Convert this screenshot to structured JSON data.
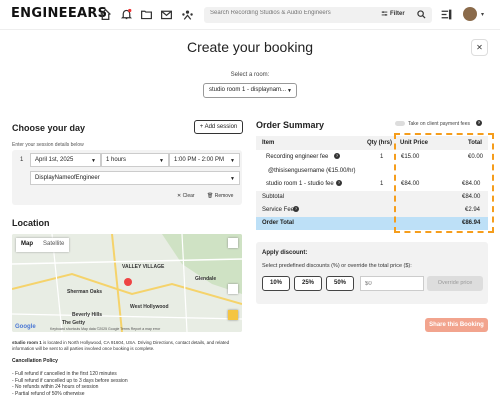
{
  "header": {
    "logo": "ENGINEEARS",
    "search_placeholder": "Search Recording Studios & Audio Engineers",
    "filter_label": "Filter"
  },
  "page": {
    "title": "Create your booking",
    "close": "✕",
    "room_label": "Select a room:",
    "room_value": "studio room 1 - displaynam..."
  },
  "choose_day": {
    "title": "Choose your day",
    "add_session": "+ Add session",
    "hint": "Enter your session details below",
    "session_number": "1",
    "date": "April 1st, 2025",
    "duration": "1 hours",
    "time": "1:00 PM - 2:00 PM",
    "engineer": "DisplayNameofEngineer",
    "clear": "Clear",
    "remove": "Remove"
  },
  "location": {
    "title": "Location",
    "map_tab": "Map",
    "satellite_tab": "Satellite",
    "places": [
      "VALLEY VILLAGE",
      "Glendale",
      "Beverly Hills",
      "West Hollywood",
      "Sherman Oaks",
      "The Getty"
    ],
    "map_footer": "Keyboard shortcuts   Map data ©2025 Google   Terms   Report a map error",
    "google": "Google",
    "room_name": "studio room 1",
    "description": "is located in North Hollywood, CA 91604, USA. Driving Directions, contact details, and related information will be sent to all parties involved once booking is complete."
  },
  "cancellation": {
    "title": "Cancellation Policy",
    "items": [
      "- Full refund if cancelled in the first 120 minutes",
      "- Full refund if cancelled up to 3 days before session",
      "- No refunds within 24 hours of session",
      "- Partial refund of 50% otherwise"
    ]
  },
  "order": {
    "title": "Order Summary",
    "toggle_label": "Take on client payment fees",
    "columns": [
      "Item",
      "Qty (hrs)",
      "Unit Price",
      "Total"
    ],
    "rows": [
      {
        "item": "Recording engineer fee",
        "qty": "1",
        "unit": "€15.00",
        "total": "€0.00"
      },
      {
        "item": "@thisisengusername (€15.00/hr)",
        "qty": "",
        "unit": "",
        "total": ""
      },
      {
        "item": "studio room 1 - studio fee",
        "qty": "1",
        "unit": "€84.00",
        "total": "€84.00"
      }
    ],
    "subtotal_label": "Subtotal",
    "subtotal": "€84.00",
    "service_label": "Service Fee",
    "service": "€2.94",
    "total_label": "Order Total",
    "total": "€86.94"
  },
  "discount": {
    "title": "Apply discount:",
    "hint": "Select predefined discounts (%) or override the total price ($):",
    "options": [
      "10%",
      "25%",
      "50%"
    ],
    "input_placeholder": "$0",
    "override": "Override price"
  },
  "share": "Share this Booking"
}
